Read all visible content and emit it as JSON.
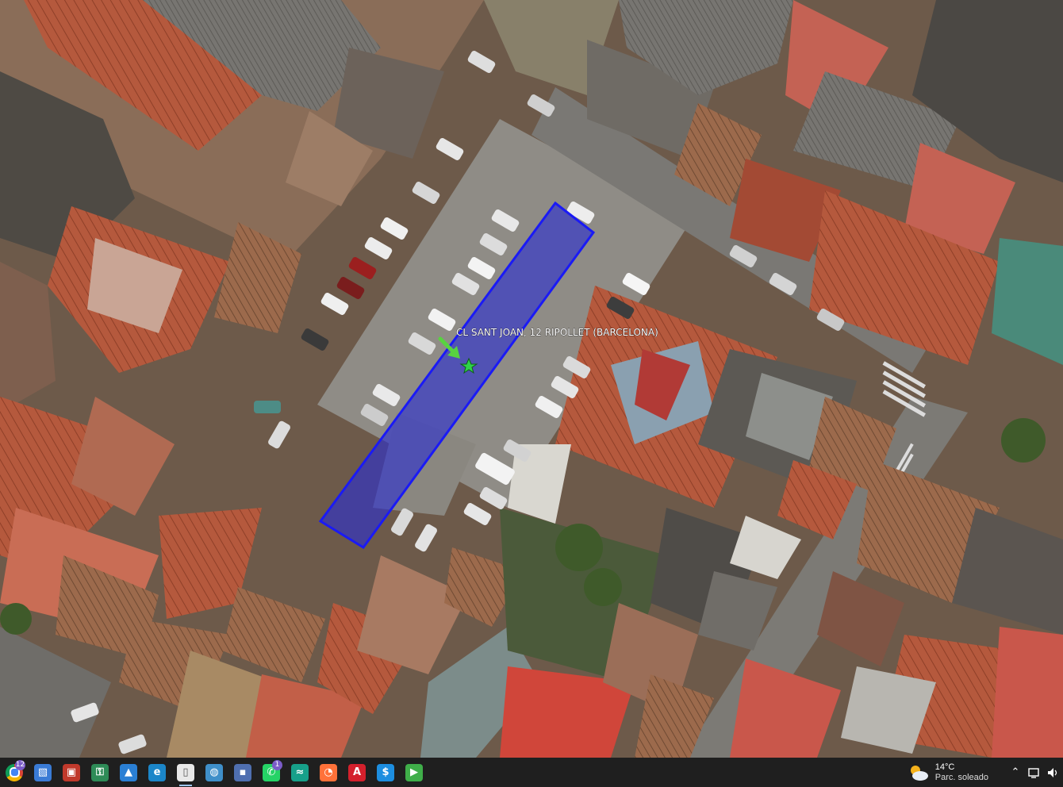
{
  "map": {
    "placemark_label": "CL SANT JOAN, 12 RIPOLLET (BARCELONA)",
    "overlay_fill": "#2b2fd0",
    "overlay_stroke": "#1a1af5",
    "marker_color": "#2fd24a",
    "pointer_color": "#58d340"
  },
  "taskbar": {
    "apps": [
      {
        "name": "chrome",
        "glyph": "",
        "badge": "12",
        "color": "#2b8de0"
      },
      {
        "name": "photos",
        "glyph": "▧",
        "badge": "",
        "color": "#3a7bd5"
      },
      {
        "name": "store",
        "glyph": "▣",
        "badge": "",
        "color": "#c0392b"
      },
      {
        "name": "lock-app",
        "glyph": "⚿",
        "badge": "",
        "color": "#2e8b57"
      },
      {
        "name": "gallery",
        "glyph": "▲",
        "badge": "",
        "color": "#2a7fd4"
      },
      {
        "name": "edge",
        "glyph": "e",
        "badge": "",
        "color": "#1b86c9"
      },
      {
        "name": "document",
        "glyph": "▯",
        "badge": "",
        "color": "#e8e8e8"
      },
      {
        "name": "earth",
        "glyph": "◍",
        "badge": "",
        "color": "#3f8fc9"
      },
      {
        "name": "save-disk",
        "glyph": "▪",
        "badge": "",
        "color": "#4f6fb0"
      },
      {
        "name": "whatsapp",
        "glyph": "✆",
        "badge": "1",
        "color": "#25d366"
      },
      {
        "name": "wave-app",
        "glyph": "≈",
        "badge": "",
        "color": "#17a08a"
      },
      {
        "name": "firefox",
        "glyph": "◔",
        "badge": "",
        "color": "#ff7139"
      },
      {
        "name": "acrobat",
        "glyph": "A",
        "badge": "",
        "color": "#d4202c"
      },
      {
        "name": "dollar-app",
        "glyph": "$",
        "badge": "",
        "color": "#1d8ee0"
      },
      {
        "name": "player",
        "glyph": "▶",
        "badge": "",
        "color": "#3fae49"
      }
    ],
    "weather_temp": "14°C",
    "weather_desc": "Parc. soleado",
    "tray_icons": [
      "chevron-up",
      "network",
      "volume"
    ]
  }
}
